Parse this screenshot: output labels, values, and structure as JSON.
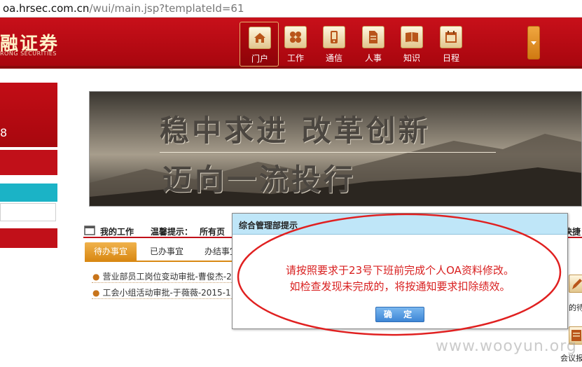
{
  "browser": {
    "url_host": "oa.hrsec.com.cn",
    "url_rest": "/wui/main.jsp?templateId=61"
  },
  "header": {
    "logo_text": "融证券",
    "logo_sub": "RONG SECURITIES",
    "nav": [
      {
        "label": "门户",
        "icon": "home-icon",
        "active": true
      },
      {
        "label": "工作",
        "icon": "work-icon",
        "active": false
      },
      {
        "label": "通信",
        "icon": "phone-icon",
        "active": false
      },
      {
        "label": "人事",
        "icon": "document-icon",
        "active": false
      },
      {
        "label": "知识",
        "icon": "book-icon",
        "active": false
      },
      {
        "label": "日程",
        "icon": "calendar-icon",
        "active": false
      }
    ]
  },
  "sidebar": {
    "glyph": "8"
  },
  "banner": {
    "line1": "稳中求进 改革创新",
    "line2": "迈向一流投行"
  },
  "work": {
    "title": "我的工作",
    "tip_label": "温馨提示：",
    "tip_text": "所有页",
    "right_text": "快捷"
  },
  "tabs": [
    "待办事宜",
    "已办事宜",
    "办结事宜"
  ],
  "tasks": [
    "营业部员工岗位变动审批-曹俊杰-2",
    "工会小组活动审批-于薇薇-2015-1"
  ],
  "right_panel": {
    "item1": "的待",
    "item2": "会议报"
  },
  "modal": {
    "title": "综合管理部提示",
    "message_line1": "请按照要求于23号下班前完成个人OA资料修改。",
    "message_line2": "如检查发现未完成的，将按通知要求扣除绩效。",
    "ok_label": "确 定"
  },
  "watermark": "www.wooyun.org",
  "colors": {
    "brand_red": "#c11019",
    "modal_text": "#d81e1e",
    "annotation_red": "#e02020",
    "modal_title_bg": "#bfe6f8"
  }
}
